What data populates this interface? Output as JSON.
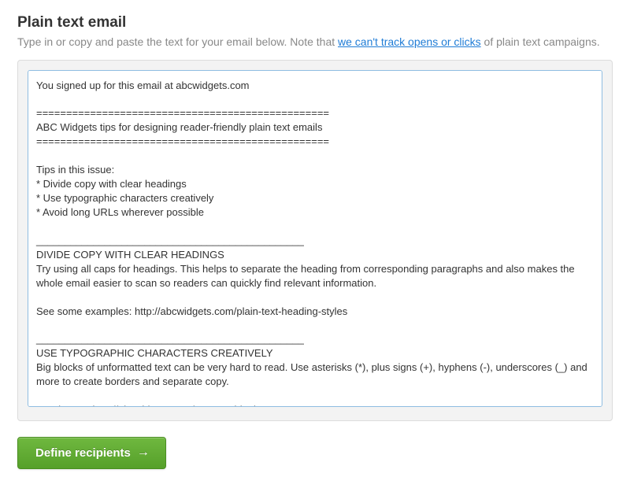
{
  "header": {
    "title": "Plain text email",
    "subtitle_prefix": "Type in or copy and paste the text for your email below. Note that ",
    "subtitle_link": "we can't track opens or clicks",
    "subtitle_suffix": " of plain text campaigns."
  },
  "editor": {
    "content": "You signed up for this email at abcwidgets.com\n\n=================================================\nABC Widgets tips for designing reader-friendly plain text emails\n=================================================\n\nTips in this issue:\n* Divide copy with clear headings\n* Use typographic characters creatively\n* Avoid long URLs wherever possible\n\n_______________________________________________\nDIVIDE COPY WITH CLEAR HEADINGS\nTry using all caps for headings. This helps to separate the heading from corresponding paragraphs and also makes the whole email easier to scan so readers can quickly find relevant information.\n\nSee some examples: http://abcwidgets.com/plain-text-heading-styles\n\n_______________________________________________\nUSE TYPOGRAPHIC CHARACTERS CREATIVELY\nBig blocks of unformatted text can be very hard to read. Use asterisks (*), plus signs (+), hyphens (-), underscores (_) and more to create borders and separate copy.\n\nRead more: http://abcwidgets.com/typographic-tips\n"
  },
  "actions": {
    "define_recipients_label": "Define recipients"
  }
}
